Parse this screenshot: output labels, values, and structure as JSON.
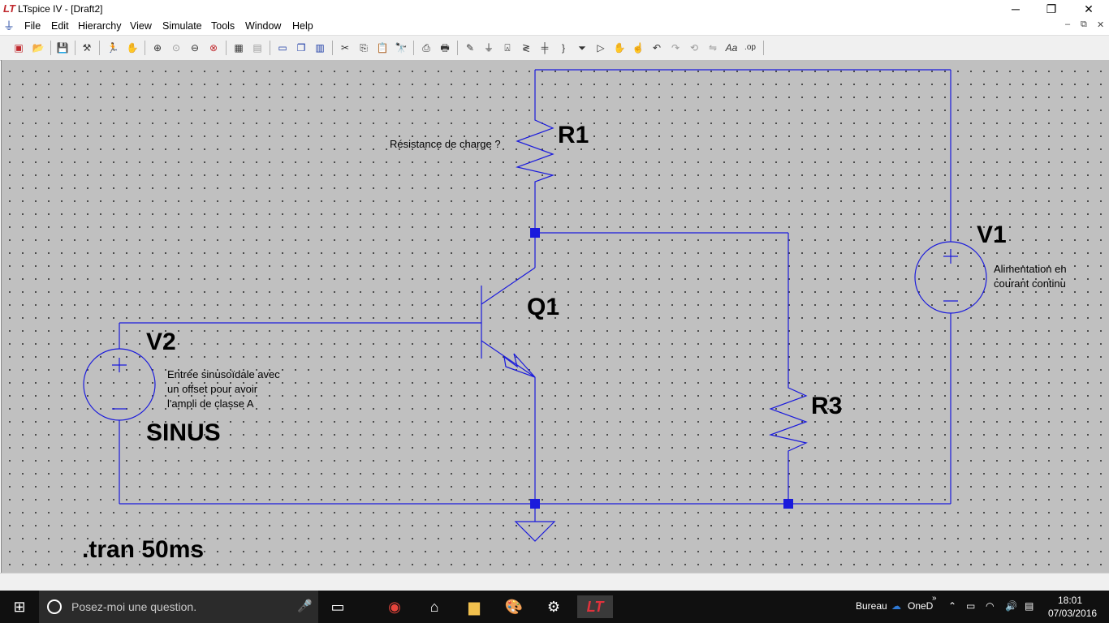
{
  "window": {
    "title": "LTspice IV - [Draft2]",
    "minimize": "─",
    "restore": "❐",
    "close": "✕"
  },
  "menu": {
    "items": [
      "File",
      "Edit",
      "Hierarchy",
      "View",
      "Simulate",
      "Tools",
      "Window",
      "Help"
    ],
    "mdi_minimize": "–",
    "mdi_restore": "⧉",
    "mdi_close": "✕"
  },
  "schematic": {
    "components": {
      "r1": {
        "ref": "R1",
        "comment": "Résistance de charge ?"
      },
      "r3": {
        "ref": "R3"
      },
      "q1": {
        "ref": "Q1"
      },
      "v1": {
        "ref": "V1",
        "comment_line1": "Alimentation en",
        "comment_line2": "courant continu"
      },
      "v2": {
        "ref": "V2",
        "value": "SINUS",
        "comment_line1": "Entrée sinusoïdale avec",
        "comment_line2": "un offset pour avoir",
        "comment_line3": "l'ampli de classe A"
      }
    },
    "directive": ".tran 50ms",
    "colors": {
      "wire": "#1a1adc",
      "component": "#1a1adc",
      "junction": "#1a1adc",
      "background": "#c0c0c0",
      "text": "#000000"
    }
  },
  "taskbar": {
    "search_placeholder": "Posez-moi une question.",
    "tray_label": "Bureau",
    "onedrive_label": "OneD",
    "time": "18:01",
    "date": "07/03/2016"
  }
}
